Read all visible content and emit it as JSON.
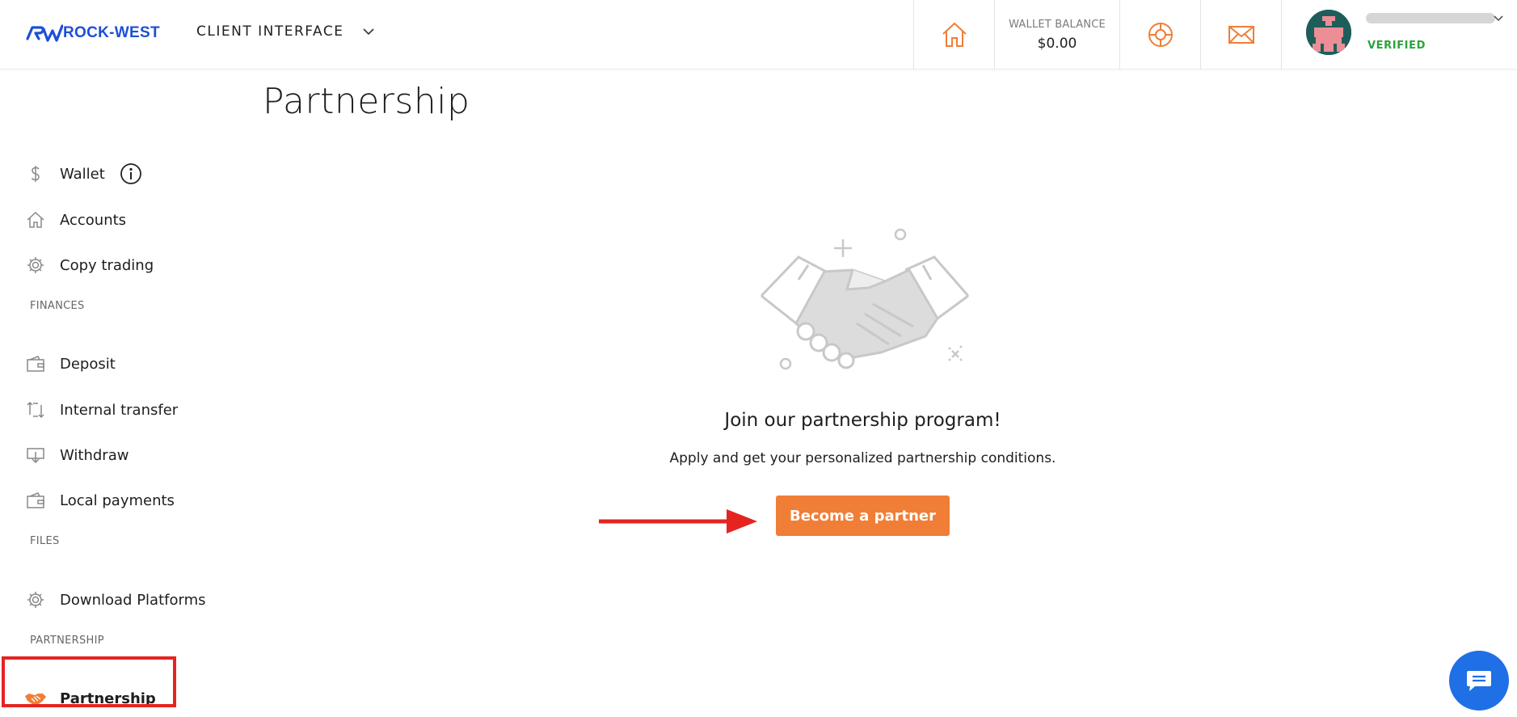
{
  "header": {
    "logo_text": "ROCK-WEST",
    "client_interface_label": "CLIENT INTERFACE",
    "wallet_balance_label": "WALLET BALANCE",
    "wallet_balance_value": "$0.00",
    "user_status": "VERIFIED"
  },
  "page": {
    "title": "Partnership"
  },
  "sidebar": {
    "items": [
      {
        "label": "Wallet",
        "icon": "dollar-icon"
      },
      {
        "label": "Accounts",
        "icon": "home-icon"
      },
      {
        "label": "Copy trading",
        "icon": "gear-icon"
      }
    ],
    "sections": [
      {
        "label": "FINANCES",
        "items": [
          {
            "label": "Deposit",
            "icon": "wallet-icon"
          },
          {
            "label": "Internal transfer",
            "icon": "transfer-icon"
          },
          {
            "label": "Withdraw",
            "icon": "withdraw-icon"
          },
          {
            "label": "Local payments",
            "icon": "wallet-icon"
          }
        ]
      },
      {
        "label": "FILES",
        "items": [
          {
            "label": "Download Platforms",
            "icon": "gear-icon"
          }
        ]
      },
      {
        "label": "PARTNERSHIP",
        "items": [
          {
            "label": "Partnership",
            "icon": "handshake-icon"
          }
        ]
      }
    ]
  },
  "main": {
    "headline": "Join our partnership program!",
    "subline": "Apply and get your personalized partnership conditions.",
    "cta_label": "Become a partner"
  },
  "colors": {
    "accent": "#f07e36",
    "brand": "#1d4fd6",
    "verified": "#2aa43a",
    "highlight": "#e52421",
    "chat": "#1f6fe6"
  }
}
